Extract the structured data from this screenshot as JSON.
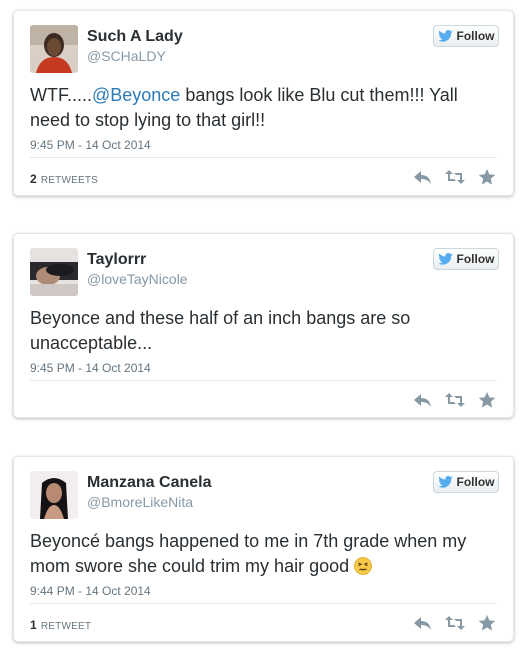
{
  "follow_label": "Follow",
  "tweets": [
    {
      "name": "Such A Lady",
      "handle": "@SCHaLDY",
      "text_pre": "WTF.....",
      "mention": "@Beyonce",
      "text_post": " bangs look like Blu cut them!!! Yall need to stop lying to that girl!!",
      "time": "9:45 PM - 14 Oct 2014",
      "retweet_count": "2",
      "retweet_label": "RETWEETS"
    },
    {
      "name": "Taylorrr",
      "handle": "@loveTayNicole",
      "text": "Beyonce and these half of an inch bangs are so unacceptable...",
      "time": "9:45 PM - 14 Oct 2014"
    },
    {
      "name": "Manzana Canela",
      "handle": "@BmoreLikeNita",
      "text": "Beyoncé bangs happened to me in 7th grade when my mom swore she could trim my hair good",
      "time": "9:44 PM - 14 Oct 2014",
      "retweet_count": "1",
      "retweet_label": "RETWEET"
    }
  ],
  "colors": {
    "link": "#2b7bb9",
    "twitter_blue": "#55acee",
    "muted": "#8899a6"
  },
  "icons": [
    "twitter-bird-icon",
    "reply-icon",
    "retweet-icon",
    "favorite-star-icon",
    "persevering-face-emoji"
  ]
}
